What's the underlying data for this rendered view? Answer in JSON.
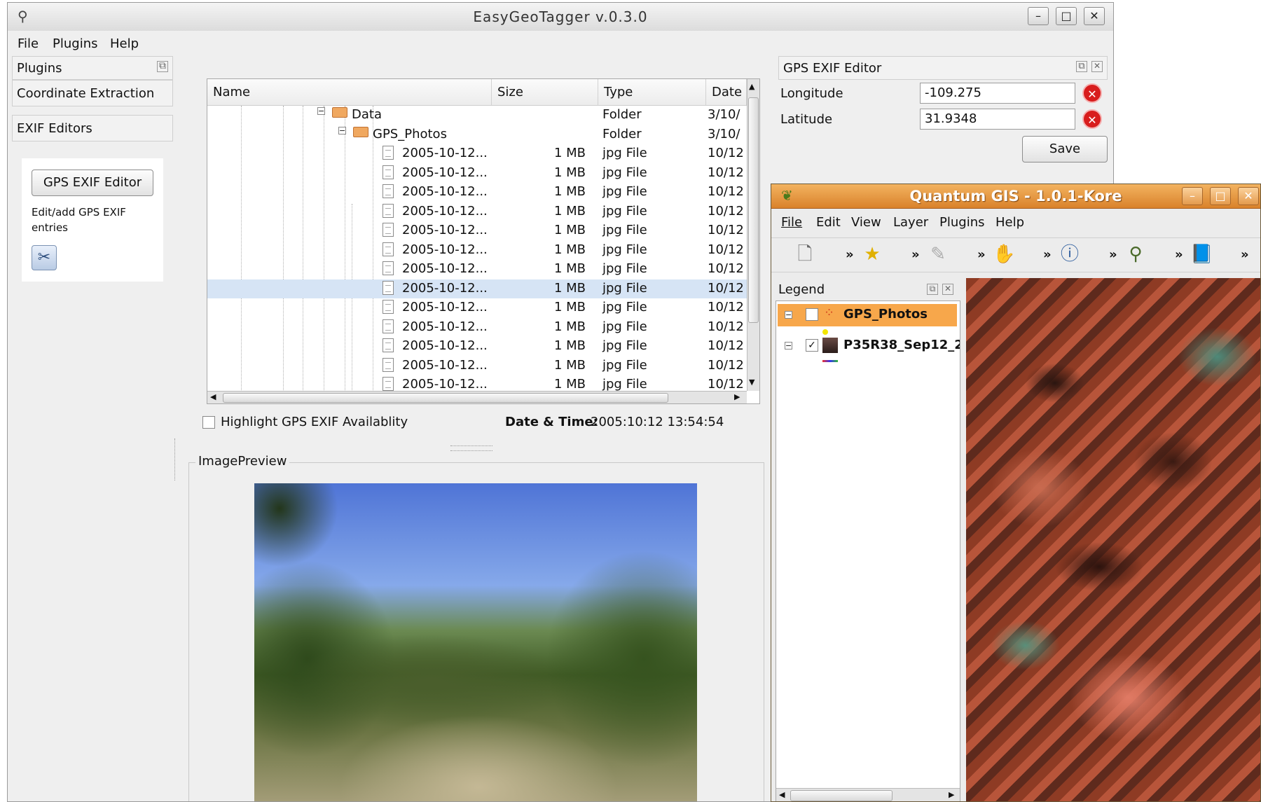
{
  "egt": {
    "title": "EasyGeoTagger v.0.3.0",
    "window_buttons": [
      "–",
      "□",
      "✕"
    ],
    "menu": [
      "File",
      "Plugins",
      "Help"
    ],
    "plugins_dock": {
      "title": "Plugins",
      "item1": "Coordinate Extraction",
      "item2": "EXIF Editors",
      "button": "GPS EXIF Editor",
      "description": "Edit/add GPS EXIF entries"
    },
    "tree": {
      "columns": [
        "Name",
        "Size",
        "Type",
        "Date"
      ],
      "folders": [
        {
          "name": "Data",
          "type": "Folder",
          "date": "3/10/"
        },
        {
          "name": "GPS_Photos",
          "type": "Folder",
          "date": "3/10/"
        }
      ],
      "files": [
        {
          "name": "2005-10-12...",
          "size": "1 MB",
          "type": "jpg File",
          "date": "10/12"
        },
        {
          "name": "2005-10-12...",
          "size": "1 MB",
          "type": "jpg File",
          "date": "10/12"
        },
        {
          "name": "2005-10-12...",
          "size": "1 MB",
          "type": "jpg File",
          "date": "10/12"
        },
        {
          "name": "2005-10-12...",
          "size": "1 MB",
          "type": "jpg File",
          "date": "10/12"
        },
        {
          "name": "2005-10-12...",
          "size": "1 MB",
          "type": "jpg File",
          "date": "10/12"
        },
        {
          "name": "2005-10-12...",
          "size": "1 MB",
          "type": "jpg File",
          "date": "10/12"
        },
        {
          "name": "2005-10-12...",
          "size": "1 MB",
          "type": "jpg File",
          "date": "10/12"
        },
        {
          "name": "2005-10-12...",
          "size": "1 MB",
          "type": "jpg File",
          "date": "10/12"
        },
        {
          "name": "2005-10-12...",
          "size": "1 MB",
          "type": "jpg File",
          "date": "10/12"
        },
        {
          "name": "2005-10-12...",
          "size": "1 MB",
          "type": "jpg File",
          "date": "10/12"
        },
        {
          "name": "2005-10-12...",
          "size": "1 MB",
          "type": "jpg File",
          "date": "10/12"
        },
        {
          "name": "2005-10-12...",
          "size": "1 MB",
          "type": "jpg File",
          "date": "10/12"
        },
        {
          "name": "2005-10-12...",
          "size": "1 MB",
          "type": "jpg File",
          "date": "10/12"
        }
      ],
      "selected_index": 7
    },
    "highlight_label": "Highlight GPS EXIF Availablity",
    "datetime_label": "Date & Time:",
    "datetime_value": "2005:10:12 13:54:54",
    "preview_title": "ImagePreview",
    "gps_editor": {
      "title": "GPS EXIF Editor",
      "longitude_label": "Longitude",
      "longitude_value": "-109.275",
      "latitude_label": "Latitude",
      "latitude_value": "31.9348",
      "save_label": "Save"
    }
  },
  "qgis": {
    "title": "Quantum GIS - 1.0.1-Kore",
    "window_buttons": [
      "–",
      "□",
      "✕"
    ],
    "menu": [
      "File",
      "Edit",
      "View",
      "Layer",
      "Plugins",
      "Help"
    ],
    "legend_title": "Legend",
    "layers": [
      {
        "name": "GPS_Photos",
        "checked": false,
        "selected": true
      },
      {
        "name": "P35R38_Sep12_2",
        "checked": true,
        "selected": false
      }
    ]
  },
  "colors": {
    "qgis_titlebar": "#e08d3b",
    "selection": "#d6e4f5",
    "legend_selected": "#f7a74b",
    "clear_button": "#d81d1d"
  }
}
